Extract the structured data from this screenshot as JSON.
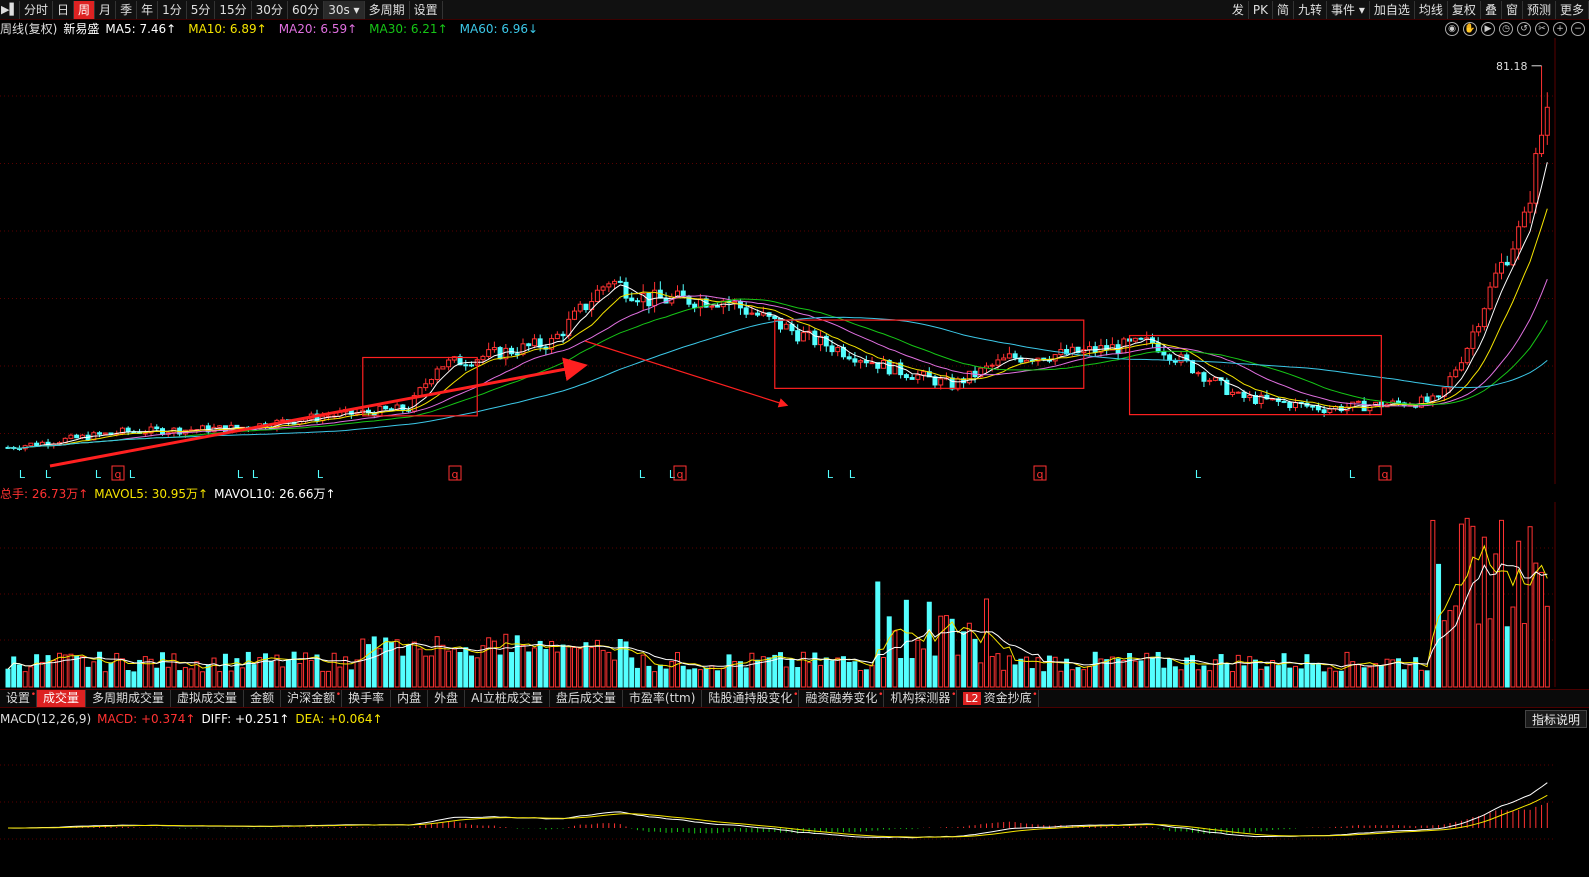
{
  "toolbar": {
    "left_items": [
      {
        "label": "分时",
        "active": false
      },
      {
        "label": "日",
        "active": false
      },
      {
        "label": "周",
        "active": true
      },
      {
        "label": "月",
        "active": false
      },
      {
        "label": "季",
        "active": false
      },
      {
        "label": "年",
        "active": false
      },
      {
        "label": "1分",
        "active": false
      },
      {
        "label": "5分",
        "active": false
      },
      {
        "label": "15分",
        "active": false
      },
      {
        "label": "30分",
        "active": false
      },
      {
        "label": "60分",
        "active": false
      },
      {
        "label": "30s",
        "active": false
      },
      {
        "label": "多周期",
        "active": false
      },
      {
        "label": "设置",
        "active": false
      }
    ],
    "right_items": [
      "发",
      "PK",
      "简",
      "九转",
      "事件",
      "加自选",
      "均线",
      "复权",
      "叠",
      "窗",
      "预测",
      "更多"
    ]
  },
  "price_panel": {
    "period": "周线(复权)",
    "name": "新易盛",
    "ma": [
      {
        "label": "MA5: 7.46↑",
        "color": "#ffffff"
      },
      {
        "label": "MA10: 6.89↑",
        "color": "#f5e400"
      },
      {
        "label": "MA20: 6.59↑",
        "color": "#e070e0"
      },
      {
        "label": "MA30: 6.21↑",
        "color": "#16c516"
      },
      {
        "label": "MA60: 6.96↓",
        "color": "#3cc8e8"
      }
    ],
    "max_price_label": "81.18",
    "signals": [
      "L",
      "L",
      "L",
      "q",
      "L",
      "L",
      "L",
      "L",
      "q",
      "L",
      "L",
      "q",
      "L",
      "L",
      "q",
      "L",
      "L",
      "q"
    ]
  },
  "volume_panel": {
    "total": "总手: 26.73万↑",
    "mavol5": "MAVOL5: 30.95万↑",
    "mavol10": "MAVOL10: 26.66万↑"
  },
  "indicator_tabs": [
    {
      "label": "设置",
      "active": false,
      "star": true
    },
    {
      "label": "成交量",
      "active": true,
      "star": false
    },
    {
      "label": "多周期成交量",
      "active": false,
      "star": false
    },
    {
      "label": "虚拟成交量",
      "active": false,
      "star": false
    },
    {
      "label": "金额",
      "active": false,
      "star": false
    },
    {
      "label": "沪深金额",
      "active": false,
      "star": true
    },
    {
      "label": "换手率",
      "active": false,
      "star": false
    },
    {
      "label": "内盘",
      "active": false,
      "star": false
    },
    {
      "label": "外盘",
      "active": false,
      "star": false
    },
    {
      "label": "AI立桩成交量",
      "active": false,
      "star": false
    },
    {
      "label": "盘后成交量",
      "active": false,
      "star": false
    },
    {
      "label": "市盈率(ttm)",
      "active": false,
      "star": false
    },
    {
      "label": "陆股通持股变化",
      "active": false,
      "star": true
    },
    {
      "label": "融资融券变化",
      "active": false,
      "star": true
    },
    {
      "label": "机构探测器",
      "active": false,
      "star": true
    },
    {
      "label": "资金抄底",
      "active": false,
      "star": true,
      "badge": "L2"
    }
  ],
  "macd_panel": {
    "name": "MACD(12,26,9)",
    "macd": "MACD: +0.374↑",
    "diff": "DIFF: +0.251↑",
    "dea": "DEA: +0.064↑",
    "help": "指标说明"
  },
  "colors": {
    "up": "#ff3232",
    "down": "#54ffff",
    "ma5": "#ffffff",
    "ma10": "#f5e400",
    "ma20": "#e070e0",
    "ma30": "#16c516",
    "ma60": "#3cc8e8"
  }
}
